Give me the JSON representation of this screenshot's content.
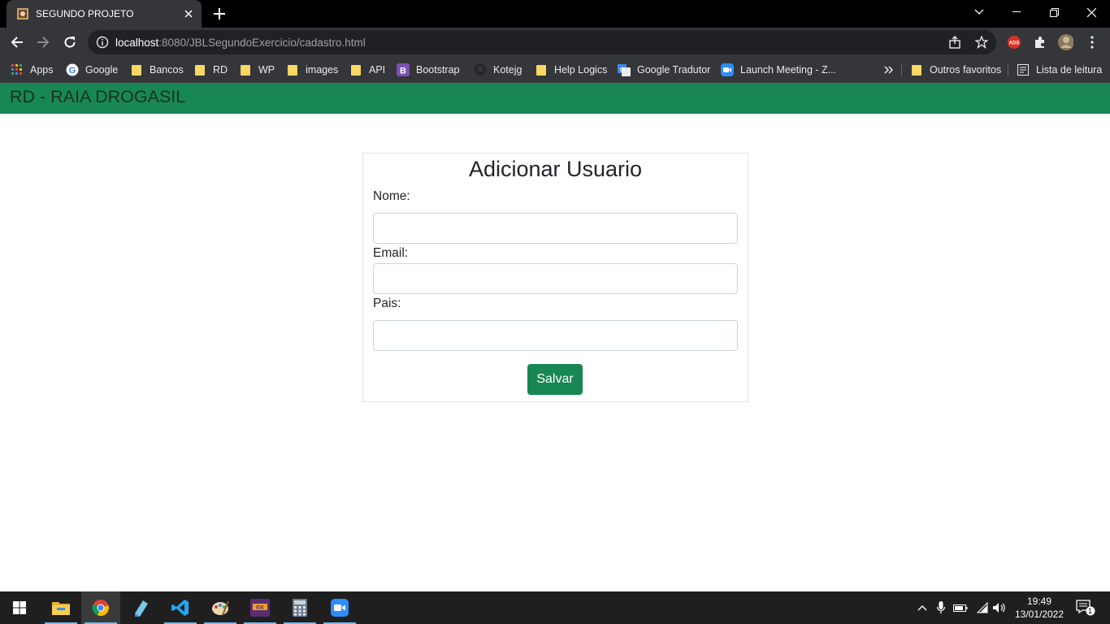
{
  "browser": {
    "tab_title": "SEGUNDO PROJETO",
    "url_host": "localhost",
    "url_rest": ":8080/JBLSegundoExercicio/cadastro.html",
    "bookmarks": [
      {
        "label": "Apps",
        "icon": "apps-grid-icon"
      },
      {
        "label": "Google",
        "icon": "google-icon"
      },
      {
        "label": "Bancos",
        "icon": "folder-icon"
      },
      {
        "label": "RD",
        "icon": "folder-icon"
      },
      {
        "label": "WP",
        "icon": "folder-icon"
      },
      {
        "label": "images",
        "icon": "folder-icon"
      },
      {
        "label": "API",
        "icon": "folder-icon"
      },
      {
        "label": "Bootstrap",
        "icon": "bootstrap-icon"
      },
      {
        "label": "Kotejg",
        "icon": "github-icon"
      },
      {
        "label": "Help Logics",
        "icon": "folder-icon"
      },
      {
        "label": "Google Tradutor",
        "icon": "google-translate-icon"
      },
      {
        "label": "Launch Meeting - Z...",
        "icon": "zoom-icon"
      }
    ],
    "other_favorites": "Outros favoritos",
    "reading_list": "Lista de leitura"
  },
  "navbar": {
    "brand": "RD - RAIA DROGASIL",
    "color": "#198754"
  },
  "form": {
    "title": "Adicionar Usuario",
    "nome_label": "Nome:",
    "nome_value": "",
    "email_label": "Email:",
    "email_value": "",
    "pais_label": "Pais:",
    "pais_value": "",
    "submit_label": "Salvar"
  },
  "taskbar": {
    "time": "19:49",
    "date": "13/01/2022",
    "notifications": "1"
  }
}
